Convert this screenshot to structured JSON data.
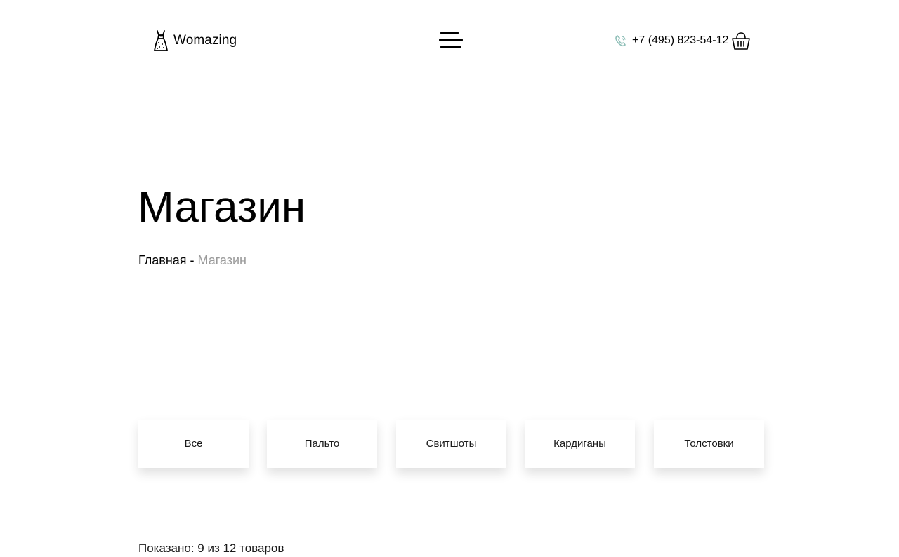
{
  "header": {
    "logo_text": "Womazing",
    "phone": "+7 (495) 823-54-12"
  },
  "icons": {
    "logo": "dress-icon",
    "menu": "hamburger-menu-icon",
    "phone": "phone-icon",
    "cart": "shopping-basket-icon"
  },
  "colors": {
    "phone_icon": "#8fbfb8",
    "breadcrumb_current": "#9a9a9a"
  },
  "main": {
    "title": "Магазин",
    "breadcrumb": {
      "home": "Главная",
      "separator": " - ",
      "current": "Магазин"
    },
    "filters": [
      "Все",
      "Пальто",
      "Свитшоты",
      "Кардиганы",
      "Толстовки"
    ],
    "shown_text": "Показано: 9 из 12 товаров"
  }
}
